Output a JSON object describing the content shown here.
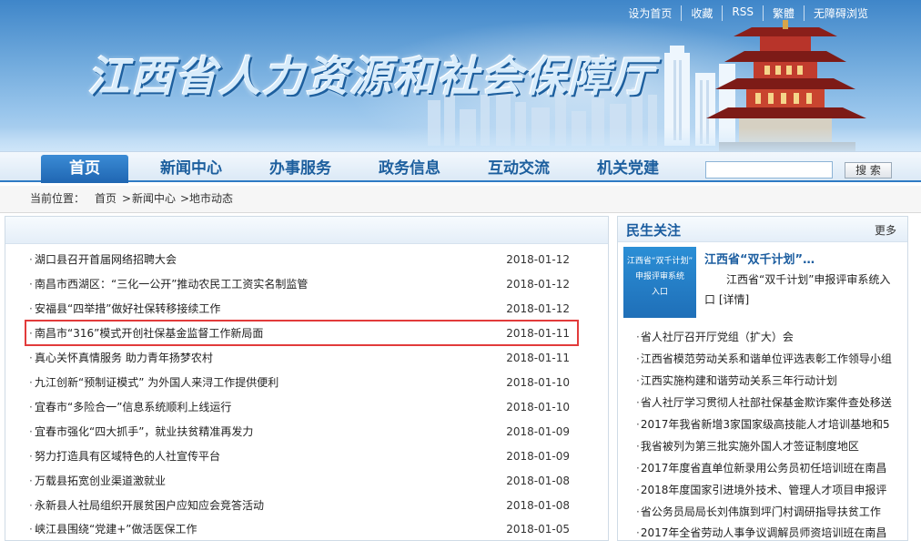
{
  "header": {
    "site_title": "江西省人力资源和社会保障厅",
    "top_links": [
      "设为首页",
      "收藏",
      "RSS",
      "繁體",
      "无障碍浏览"
    ]
  },
  "nav": {
    "items": [
      "首页",
      "新闻中心",
      "办事服务",
      "政务信息",
      "互动交流",
      "机关党建"
    ],
    "active_index": 0,
    "search_placeholder": "",
    "search_button": "搜 索"
  },
  "breadcrumb": {
    "label": "当前位置：",
    "path": [
      "首页",
      "新闻中心",
      "地市动态"
    ],
    "separator": ">"
  },
  "news": [
    {
      "title": "湖口县召开首届网络招聘大会",
      "date": "2018-01-12"
    },
    {
      "title": "南昌市西湖区：“三化一公开”推动农民工工资实名制监管",
      "date": "2018-01-12"
    },
    {
      "title": "安福县“四举措”做好社保转移接续工作",
      "date": "2018-01-12"
    },
    {
      "title": "南昌市“316”模式开创社保基金监督工作新局面",
      "date": "2018-01-11",
      "highlighted": true
    },
    {
      "title": "真心关怀真情服务  助力青年扬梦农村",
      "date": "2018-01-11"
    },
    {
      "title": "九江创新“预制证模式”  为外国人来浔工作提供便利",
      "date": "2018-01-10"
    },
    {
      "title": "宜春市“多险合一”信息系统顺利上线运行",
      "date": "2018-01-10"
    },
    {
      "title": "宜春市强化“四大抓手”，就业扶贫精准再发力",
      "date": "2018-01-09"
    },
    {
      "title": "努力打造具有区域特色的人社宣传平台",
      "date": "2018-01-09"
    },
    {
      "title": "万载县拓宽创业渠道激就业",
      "date": "2018-01-08"
    },
    {
      "title": "永新县人社局组织开展贫困户应知应会竞答活动",
      "date": "2018-01-08"
    },
    {
      "title": "峡江县围绕“党建+”做活医保工作",
      "date": "2018-01-05"
    }
  ],
  "sidebar": {
    "title": "民生关注",
    "more": "更多",
    "feature": {
      "image_text": [
        "江西省“双千计划”",
        "申报评审系统",
        "入口"
      ],
      "title": "江西省“双千计划”…",
      "desc": "江西省“双千计划”申报评审系统入口  [详情]"
    },
    "items": [
      "省人社厅召开厅党组（扩大）会",
      "江西省模范劳动关系和谐单位评选表彰工作领导小组",
      "江西实施构建和谐劳动关系三年行动计划",
      "省人社厅学习贯彻人社部社保基金欺诈案件查处移送",
      "2017年我省新增3家国家级高技能人才培训基地和5",
      "我省被列为第三批实施外国人才签证制度地区",
      "2017年度省直单位新录用公务员初任培训班在南昌",
      "2018年度国家引进境外技术、管理人才项目申报评",
      "省公务员局局长刘伟旗到坪门村调研指导扶贫工作",
      "2017年全省劳动人事争议调解员师资培训班在南昌"
    ]
  },
  "colors": {
    "brand_blue": "#1f66b2",
    "highlight_border": "#e23b3b"
  }
}
